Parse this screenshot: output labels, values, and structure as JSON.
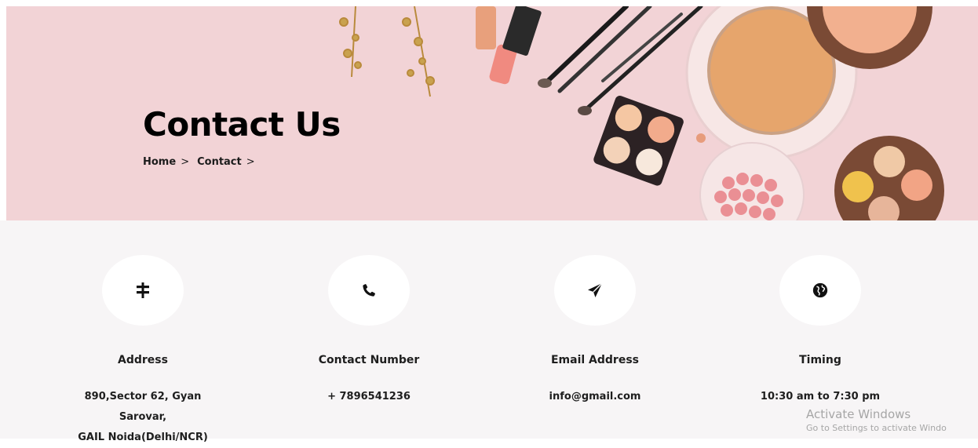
{
  "hero": {
    "title": "Contact Us",
    "breadcrumb": [
      {
        "label": "Home",
        "sep": ">"
      },
      {
        "label": "Contact",
        "sep": ">"
      }
    ],
    "background_color": "#f2d3d6"
  },
  "cards": [
    {
      "icon": "signpost-icon",
      "title": "Address",
      "lines": [
        "890,Sector 62, Gyan Sarovar,",
        "GAIL Noida(Delhi/NCR)"
      ]
    },
    {
      "icon": "phone-icon",
      "title": "Contact Number",
      "lines": [
        "+ 7896541236"
      ]
    },
    {
      "icon": "paper-plane-icon",
      "title": "Email Address",
      "lines": [
        "info@gmail.com"
      ]
    },
    {
      "icon": "globe-icon",
      "title": "Timing",
      "lines": [
        "10:30 am to 7:30 pm"
      ]
    }
  ],
  "watermark": {
    "line1": "Activate Windows",
    "line2": "Go to Settings to activate Windo"
  }
}
